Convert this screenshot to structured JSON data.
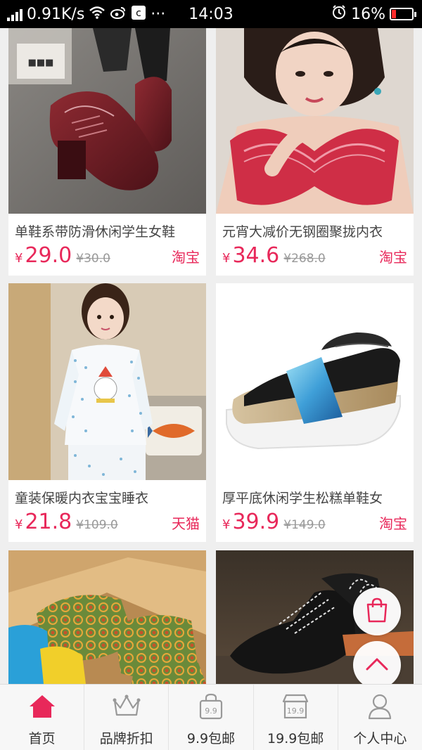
{
  "status_bar": {
    "speed": "0.91K/s",
    "time": "14:03",
    "battery": "16%",
    "more": "···"
  },
  "products": [
    {
      "title": "单鞋系带防滑休闲学生女鞋",
      "price_symbol": "¥",
      "price": "29.0",
      "old_price": "¥30.0",
      "shop": "淘宝"
    },
    {
      "title": "元宵大减价无钢圈聚拢内衣",
      "price_symbol": "¥",
      "price": "34.6",
      "old_price": "¥268.0",
      "shop": "淘宝"
    },
    {
      "title": "童装保暖内衣宝宝睡衣",
      "price_symbol": "¥",
      "price": "21.8",
      "old_price": "¥109.0",
      "shop": "天猫"
    },
    {
      "title": "厚平底休闲学生松糕单鞋女",
      "price_symbol": "¥",
      "price": "39.9",
      "old_price": "¥149.0",
      "shop": "淘宝"
    },
    {
      "title": "",
      "price_symbol": "",
      "price": "",
      "old_price": "",
      "shop": ""
    },
    {
      "title": "",
      "price_symbol": "",
      "price": "",
      "old_price": "",
      "shop": ""
    }
  ],
  "image_text": {
    "price_tag_nine": "9.9",
    "price_tag_nineteen": "19.9"
  },
  "bottom_nav": [
    {
      "label": "首页",
      "icon": "home-icon",
      "active": true
    },
    {
      "label": "品牌折扣",
      "icon": "crown-icon",
      "active": false
    },
    {
      "label": "9.9包邮",
      "icon": "bag-9-9-icon",
      "active": false
    },
    {
      "label": "19.9包邮",
      "icon": "store-19-9-icon",
      "active": false
    },
    {
      "label": "个人中心",
      "icon": "user-icon",
      "active": false
    }
  ],
  "colors": {
    "accent": "#e8285a",
    "status_bar": "#000000",
    "page_bg": "#efefef"
  }
}
